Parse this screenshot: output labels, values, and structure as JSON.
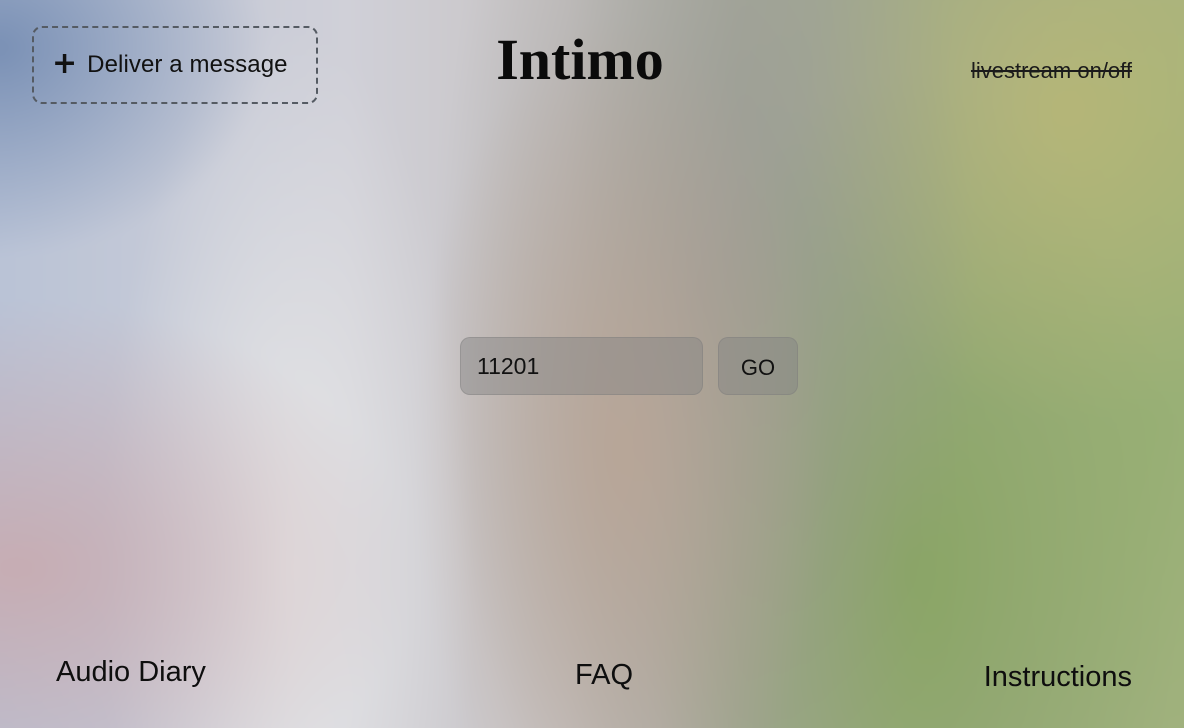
{
  "header": {
    "deliver_button_label": "Deliver a message",
    "title": "Intimo",
    "livestream_label": "livestream on/off"
  },
  "search": {
    "value": "11201",
    "go_label": "GO"
  },
  "footer": {
    "audio_diary": "Audio Diary",
    "faq": "FAQ",
    "instructions": "Instructions"
  },
  "icons": {
    "plus": "plus-icon"
  }
}
